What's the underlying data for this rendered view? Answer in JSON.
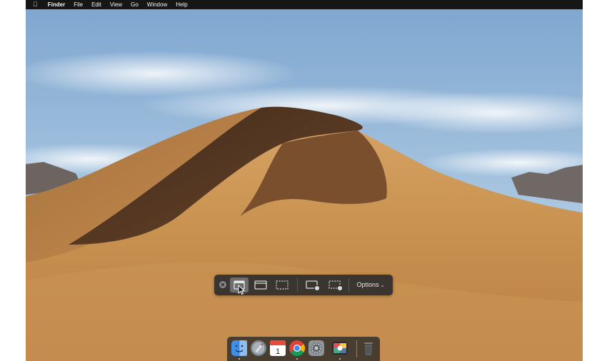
{
  "menubar": {
    "apple_icon": "apple-logo-icon",
    "app_name": "Finder",
    "items": [
      "File",
      "Edit",
      "View",
      "Go",
      "Window",
      "Help"
    ]
  },
  "wallpaper": {
    "name": "macOS Mojave desert dune",
    "colors": {
      "sky": "#8fb4d8",
      "sand": "#c8914f",
      "shadow": "#5a3a22"
    }
  },
  "screenshot_toolbar": {
    "buttons": [
      {
        "icon": "close-icon",
        "label": ""
      },
      {
        "icon": "capture-entire-screen-icon",
        "label": "",
        "selected": true
      },
      {
        "icon": "capture-window-icon",
        "label": ""
      },
      {
        "icon": "capture-selected-portion-icon",
        "label": ""
      },
      {
        "icon": "record-entire-screen-icon",
        "label": ""
      },
      {
        "icon": "record-selected-portion-icon",
        "label": ""
      }
    ],
    "options_label": "Options",
    "options_chevron": "chevron-down-icon"
  },
  "dock": {
    "apps": [
      {
        "icon": "finder-icon",
        "running": true
      },
      {
        "icon": "launchpad-icon",
        "running": false
      },
      {
        "icon": "calendar-icon",
        "running": false,
        "calendar_day": "1"
      },
      {
        "icon": "chrome-icon",
        "running": true
      },
      {
        "icon": "system-preferences-icon",
        "running": false
      },
      {
        "icon": "photo-booth-icon",
        "running": true
      },
      {
        "icon": "trash-icon",
        "running": false
      }
    ]
  }
}
